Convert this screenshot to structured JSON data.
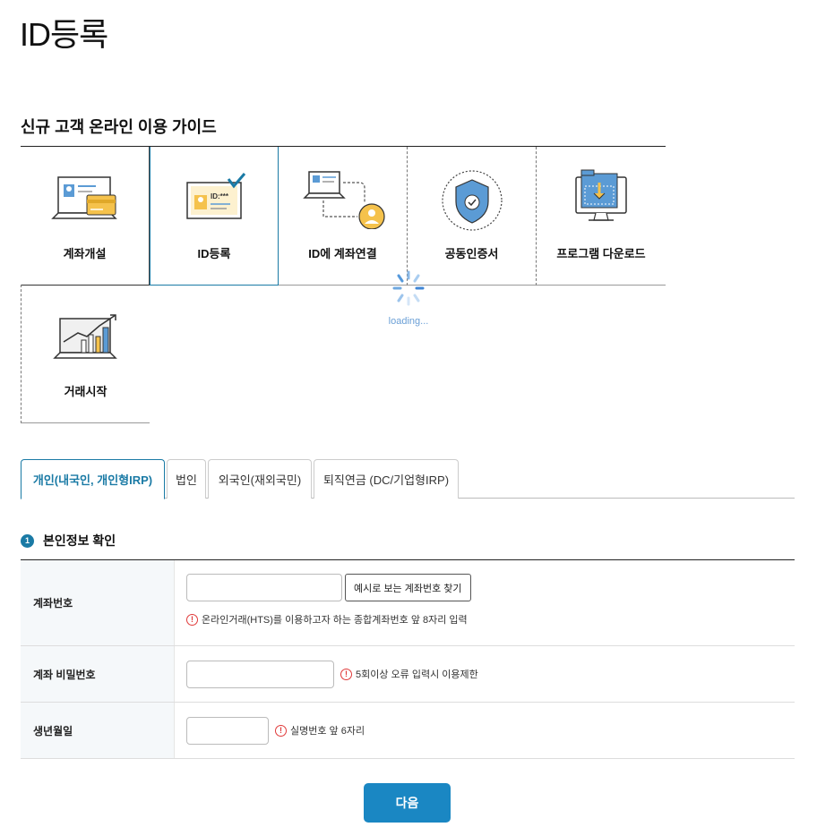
{
  "page": {
    "title": "ID등록"
  },
  "guide": {
    "title": "신규 고객 온라인 이용 가이드",
    "items": [
      {
        "label": "계좌개설",
        "icon": "account-card-icon"
      },
      {
        "label": "ID등록",
        "icon": "id-card-check-icon"
      },
      {
        "label": "ID에 계좌연결",
        "icon": "laptop-user-link-icon"
      },
      {
        "label": "공동인증서",
        "icon": "shield-check-icon"
      },
      {
        "label": "프로그램 다운로드",
        "icon": "monitor-download-icon"
      },
      {
        "label": "거래시작",
        "icon": "chart-growth-icon"
      }
    ],
    "loading_text": "loading..."
  },
  "tabs": [
    {
      "label": "개인(내국인, 개인형IRP)",
      "active": true
    },
    {
      "label": "법인",
      "active": false
    },
    {
      "label": "외국인(재외국민)",
      "active": false
    },
    {
      "label": "퇴직연금 (DC/기업형IRP)",
      "active": false
    }
  ],
  "section": {
    "step": "1",
    "title": "본인정보 확인"
  },
  "form": {
    "account_number": {
      "label": "계좌번호",
      "value": "",
      "button": "예시로 보는 계좌번호 찾기",
      "hint": "온라인거래(HTS)를 이용하고자 하는 종합계좌번호 앞 8자리 입력"
    },
    "account_password": {
      "label": "계좌 비밀번호",
      "value": "",
      "hint": "5회이상 오류 입력시 이용제한"
    },
    "birth_date": {
      "label": "생년월일",
      "value": "",
      "hint": "실명번호 앞 6자리"
    }
  },
  "next_button": "다음",
  "colors": {
    "accent": "#1a7aa5",
    "button": "#1a87c3",
    "warning": "#e03a3a",
    "icon_blue": "#5b9bd5",
    "icon_yellow": "#f5c24c"
  }
}
